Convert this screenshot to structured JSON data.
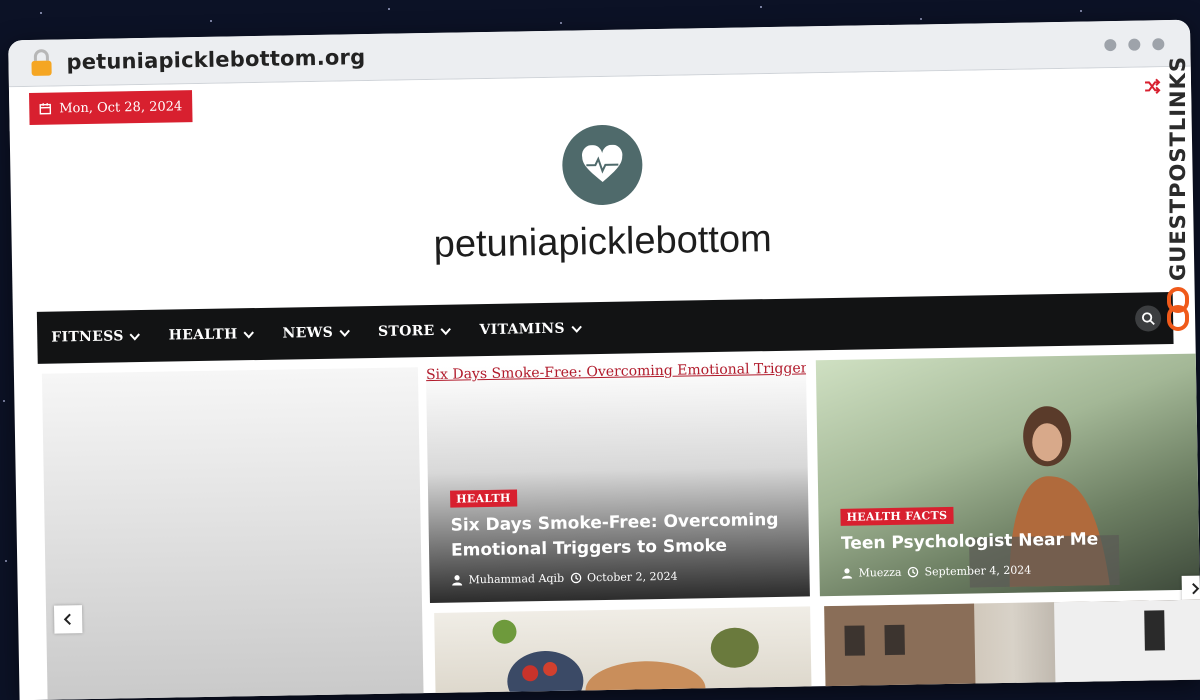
{
  "browser": {
    "url": "petuniapicklebottom.org"
  },
  "topbar": {
    "date": "Mon, Oct 28, 2024"
  },
  "site": {
    "name": "petuniapicklebottom"
  },
  "nav": {
    "items": [
      {
        "label": "FITNESS"
      },
      {
        "label": "HEALTH"
      },
      {
        "label": "NEWS"
      },
      {
        "label": "STORE"
      },
      {
        "label": "VITAMINS"
      }
    ]
  },
  "cards": {
    "featured_mid": {
      "broken_alt": "Six Days Smoke-Free: Overcoming Emotional Triggers to Smoke",
      "category": "HEALTH",
      "title": "Six Days Smoke-Free: Overcoming Emotional Triggers to Smoke",
      "author": "Muhammad Aqib",
      "date": "October 2, 2024"
    },
    "featured_right": {
      "category": "HEALTH FACTS",
      "title": "Teen Psychologist Near Me",
      "author": "Muezza",
      "date": "September 4, 2024"
    }
  },
  "watermark": {
    "text": "GUESTPOSTLINKS"
  },
  "colors": {
    "accent": "#d8202f",
    "nav_bg": "#121314",
    "logo_bg": "#4f6a6b"
  }
}
